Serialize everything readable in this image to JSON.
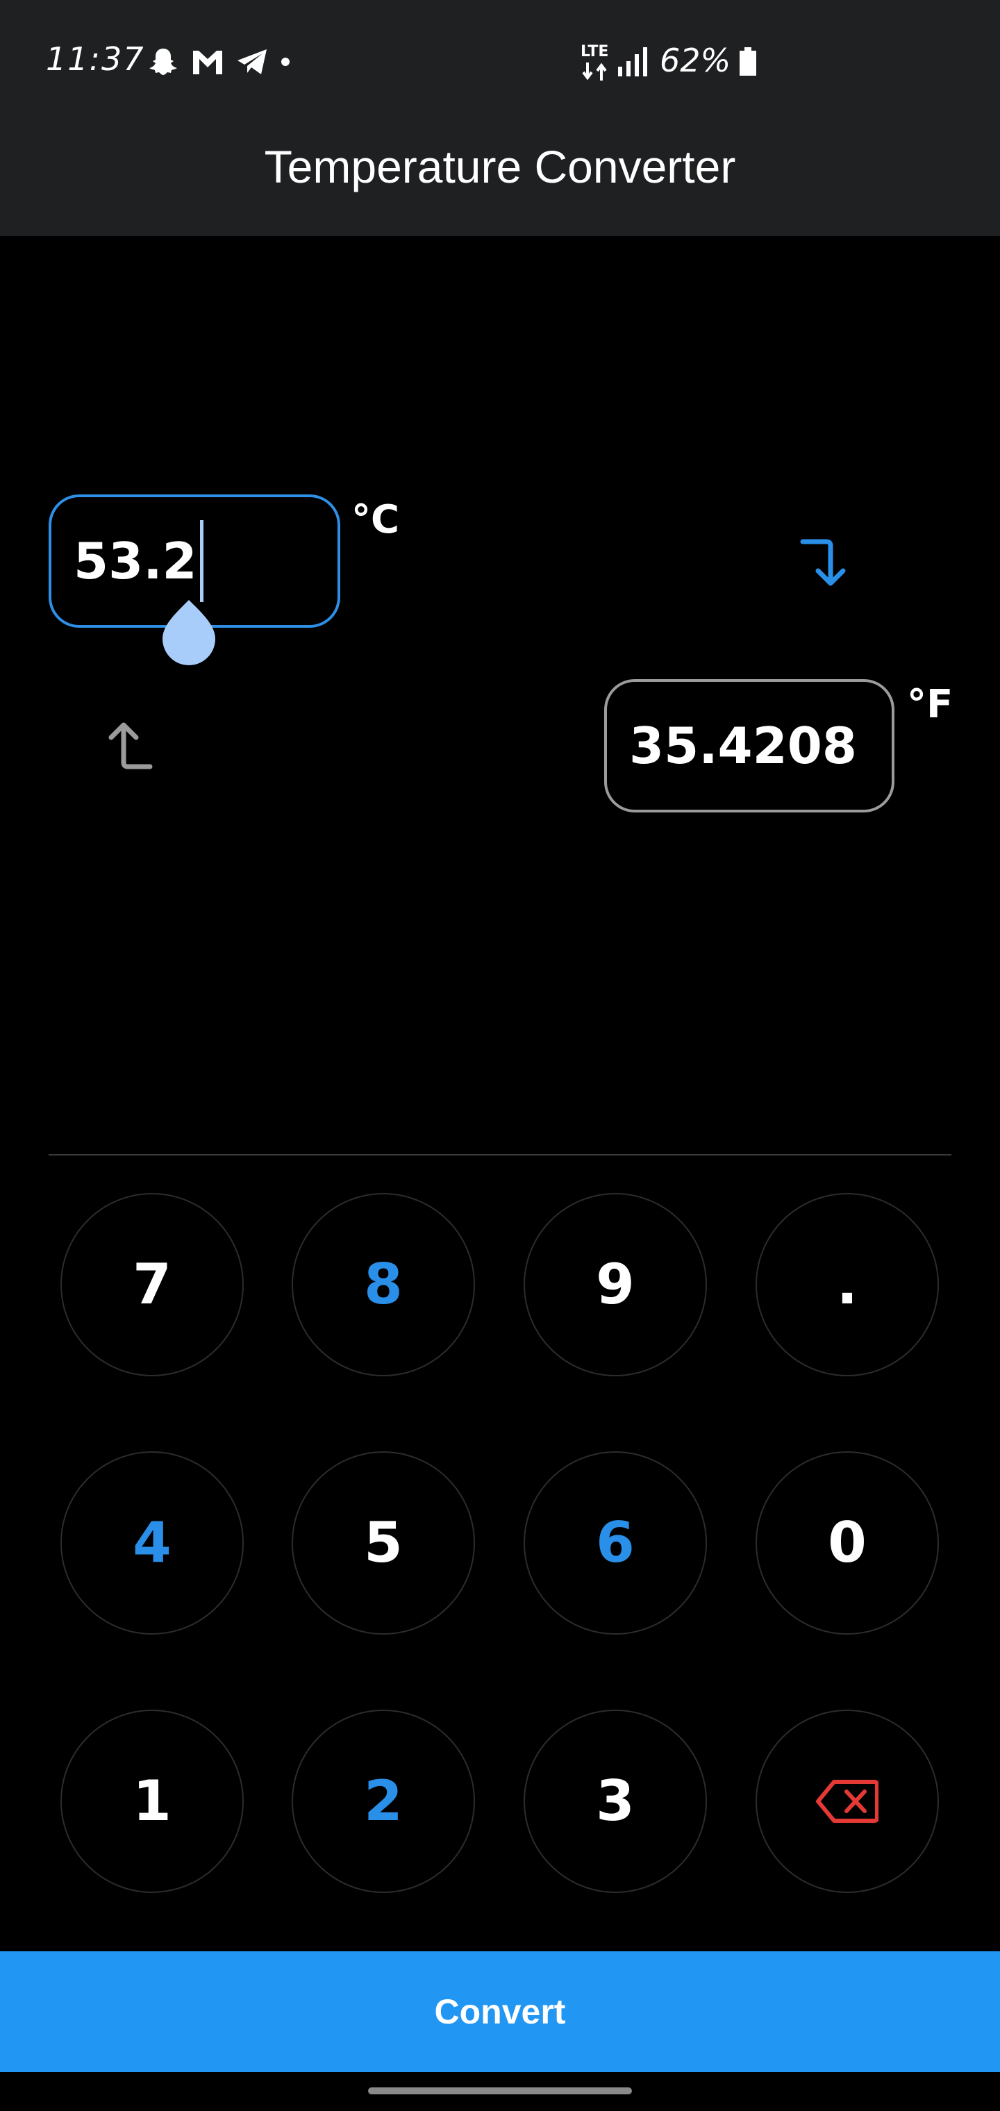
{
  "status_bar": {
    "time": "11:37",
    "network": "LTE",
    "battery": "62%"
  },
  "app_bar": {
    "title": "Temperature Converter"
  },
  "celsius": {
    "value": "53.2",
    "unit": "°C"
  },
  "fahrenheit": {
    "value": "35.4208",
    "unit": "°F"
  },
  "keypad": {
    "keys": [
      "7",
      "8",
      "9",
      ".",
      "4",
      "5",
      "6",
      "0",
      "1",
      "2",
      "3"
    ]
  },
  "convert": {
    "label": "Convert"
  },
  "colors": {
    "accent": "#2196f3",
    "field_active": "#2f8ee6",
    "key_blue": "#2a8fe8",
    "backspace_red": "#e53935",
    "surface": "#1f2022"
  }
}
